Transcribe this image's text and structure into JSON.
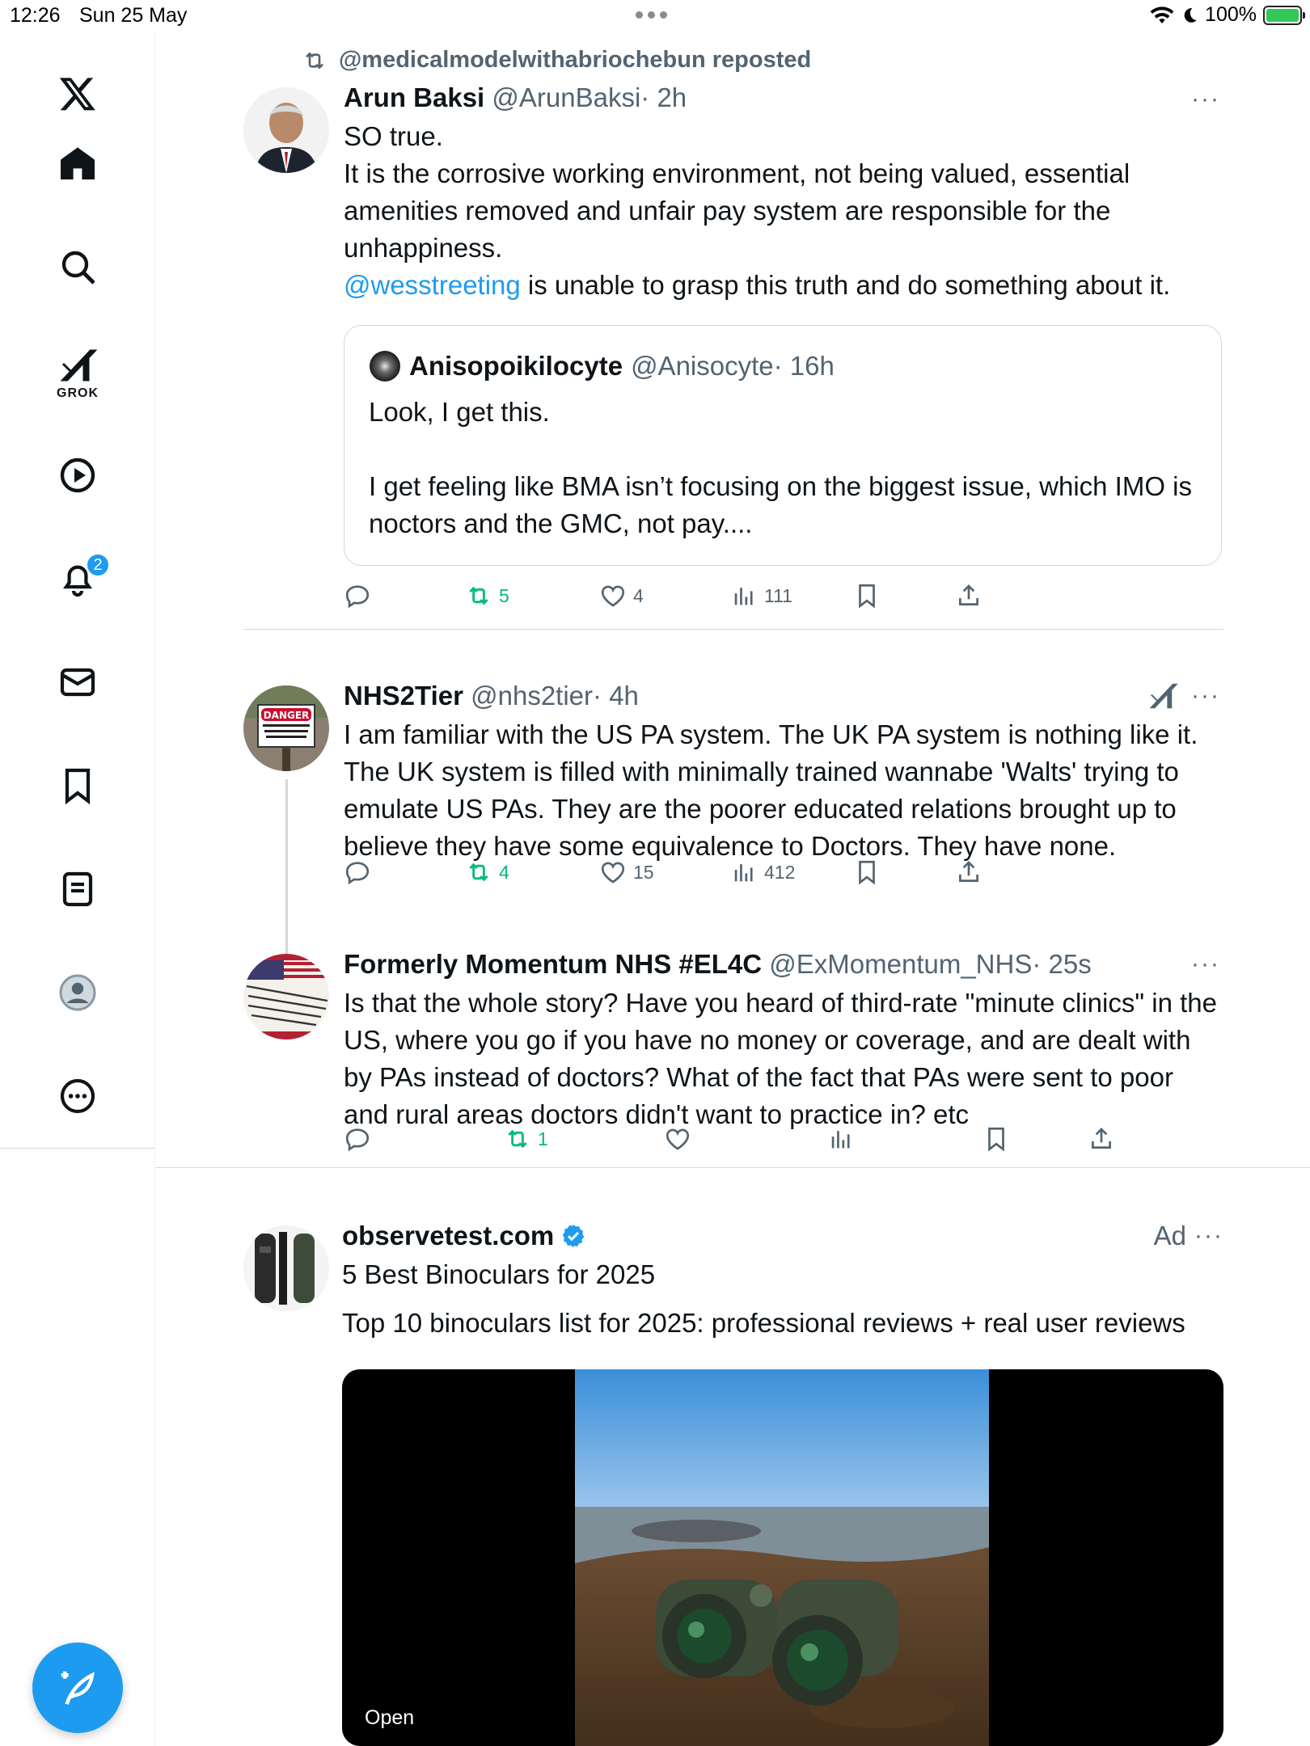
{
  "status": {
    "time": "12:26",
    "date": "Sun 25 May",
    "battery": "100%"
  },
  "sidebar": {
    "grok_label": "GROK",
    "notification_count": "2",
    "items": [
      "x-logo",
      "home-icon",
      "search-icon",
      "grok-icon",
      "video-icon",
      "notifications-icon",
      "messages-icon",
      "bookmarks-icon",
      "lists-icon",
      "profile-icon",
      "more-icon"
    ]
  },
  "post1": {
    "repost_label": "@medicalmodelwithabriochebun reposted",
    "name": "Arun Baksi",
    "handle": "@ArunBaksi",
    "time": "· 2h",
    "lines": [
      "SO true.",
      "It is the corrosive working environment, not being valued, essential amenities removed and unfair pay system are responsible for the unhappiness."
    ],
    "mention": "@wesstreeting",
    "mention_rest": " is unable to grasp this truth and do something about it.",
    "quote": {
      "name": "Anisopoikilocyte",
      "handle": "@Anisocyte",
      "time": "· 16h",
      "line1": "Look, I get this.",
      "line2": "I get feeling like BMA isn’t focusing on the biggest issue, which IMO is noctors and the GMC, not pay...."
    },
    "stats": {
      "reposts": "5",
      "likes": "4",
      "views": "111"
    }
  },
  "post2": {
    "name": "NHS2Tier",
    "handle": "@nhs2tier",
    "time": "· 4h",
    "text": "I am familiar with the US PA system. The UK PA system is nothing like it. The UK system is filled with minimally trained wannabe 'Walts' trying to emulate US PAs. They are the poorer educated relations brought up to believe they have some equivalence to Doctors. They have none.",
    "stats": {
      "reposts": "4",
      "likes": "15",
      "views": "412"
    }
  },
  "post3": {
    "name": "Formerly Momentum NHS #EL4C",
    "handle": "@ExMomentum_NHS",
    "time": "· 25s",
    "text": "Is that the whole story? Have you heard of third-rate \"minute clinics\" in the US,  where you go if you have no money or coverage, and are dealt with by PAs instead of doctors? What of the fact that PAs were sent to poor and rural areas doctors didn't want to practice in? etc",
    "stats": {
      "reposts": "1"
    }
  },
  "ad": {
    "name": "observetest.com",
    "ad_label": "Ad",
    "title": "5 Best Binoculars for 2025",
    "description": "Top 10 binoculars list for 2025: professional reviews + real user reviews",
    "open_label": "Open"
  },
  "colors": {
    "accent": "#1d9bf0",
    "repost_green": "#00ba7c",
    "muted": "#536471"
  }
}
